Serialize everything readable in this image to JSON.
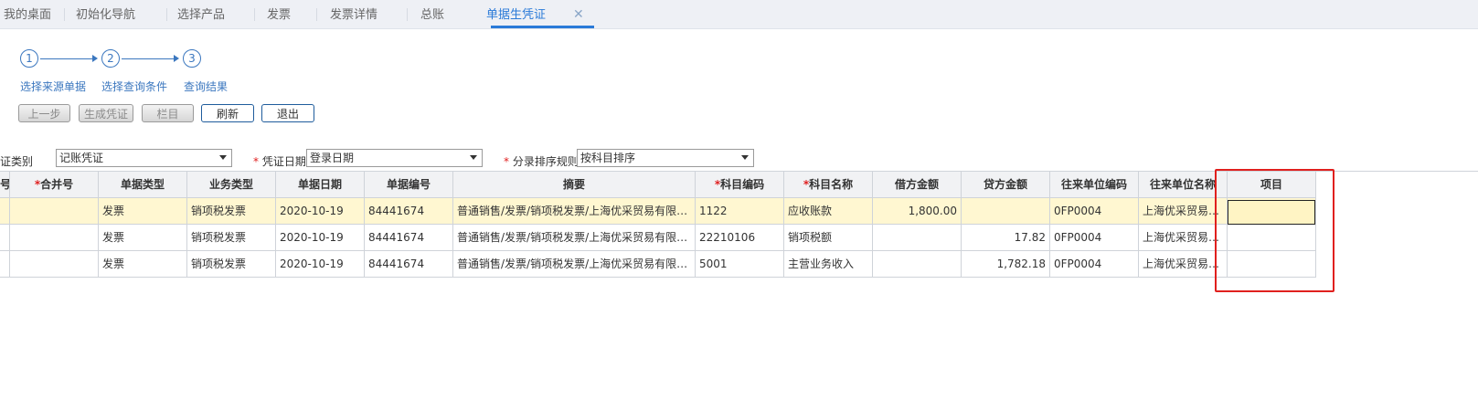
{
  "tabs": [
    {
      "label": "我的桌面"
    },
    {
      "label": "初始化导航"
    },
    {
      "label": "选择产品"
    },
    {
      "label": "发票"
    },
    {
      "label": "发票详情"
    },
    {
      "label": "总账"
    },
    {
      "label": "单据生凭证",
      "active": true
    }
  ],
  "tab_close": "✕",
  "steps": [
    {
      "num": "1",
      "label": "选择来源单据"
    },
    {
      "num": "2",
      "label": "选择查询条件"
    },
    {
      "num": "3",
      "label": "查询结果"
    }
  ],
  "buttons": [
    {
      "label": "上一步",
      "enabled": false
    },
    {
      "label": "生成凭证",
      "enabled": false
    },
    {
      "label": "栏目",
      "enabled": false
    },
    {
      "label": "刷新",
      "enabled": true
    },
    {
      "label": "退出",
      "enabled": true
    }
  ],
  "filters": {
    "voucher_type_label": "证类别",
    "voucher_type_value": "记账凭证",
    "voucher_date_label": "凭证日期",
    "voucher_date_value": "登录日期",
    "sort_rule_label": "分录排序规则",
    "sort_rule_value": "按科目排序"
  },
  "table": {
    "headers": [
      "号",
      "合并号",
      "单据类型",
      "业务类型",
      "单据日期",
      "单据编号",
      "摘要",
      "科目编码",
      "科目名称",
      "借方金额",
      "贷方金额",
      "往来单位编码",
      "往来单位名称",
      "项目"
    ],
    "required_headers": [
      "合并号",
      "科目编码",
      "科目名称"
    ],
    "rows": [
      [
        "",
        "",
        "发票",
        "销项税发票",
        "2020-10-19",
        "84441674",
        "普通销售/发票/销项税发票/上海优采贸易有限公司",
        "1122",
        "应收账款",
        "1,800.00",
        "",
        "0FP0004",
        "上海优采贸易有限公司",
        ""
      ],
      [
        "",
        "",
        "发票",
        "销项税发票",
        "2020-10-19",
        "84441674",
        "普通销售/发票/销项税发票/上海优采贸易有限公司",
        "22210106",
        "销项税额",
        "",
        "17.82",
        "0FP0004",
        "上海优采贸易有限公司",
        ""
      ],
      [
        "",
        "",
        "发票",
        "销项税发票",
        "2020-10-19",
        "84441674",
        "普通销售/发票/销项税发票/上海优采贸易有限公司",
        "5001",
        "主营业务收入",
        "",
        "1,782.18",
        "0FP0004",
        "上海优采贸易有限公司",
        ""
      ]
    ],
    "selected_row": 0
  },
  "colors": {
    "accent": "#2a7ad8",
    "step": "#3b77bf",
    "selected_row": "#fff7d1",
    "annotation_box": "#e0201e"
  }
}
